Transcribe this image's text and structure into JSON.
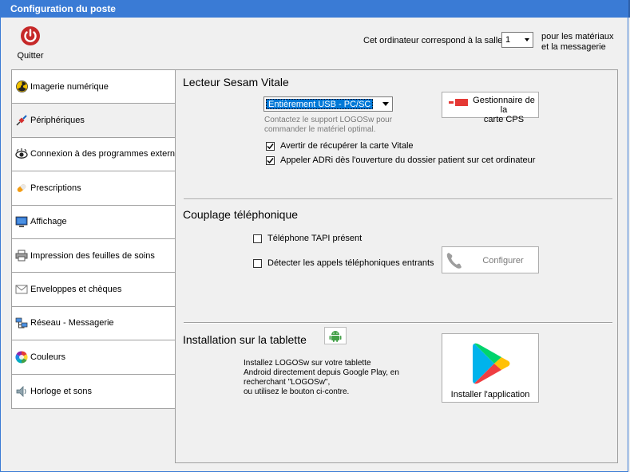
{
  "window": {
    "title": "Configuration du poste"
  },
  "toolbar": {
    "quit_label": "Quitter"
  },
  "salle": {
    "label": "Cet ordinateur correspond à la salle",
    "value": "1",
    "suffix_line1": "pour les matériaux",
    "suffix_line2": "et la messagerie"
  },
  "nav": {
    "items": [
      {
        "label": "Imagerie numérique",
        "icon": "radiation-icon"
      },
      {
        "label": "Périphériques",
        "icon": "cable-icon"
      },
      {
        "label": "Connexion à des programmes externes",
        "icon": "eye-icon"
      },
      {
        "label": "Prescriptions",
        "icon": "pill-icon"
      },
      {
        "label": "Affichage",
        "icon": "monitor-icon"
      },
      {
        "label": "Impression des feuilles de soins",
        "icon": "printer-icon"
      },
      {
        "label": "Enveloppes et chèques",
        "icon": "envelope-icon"
      },
      {
        "label": "Réseau - Messagerie",
        "icon": "network-icon"
      },
      {
        "label": "Couleurs",
        "icon": "color-wheel-icon"
      },
      {
        "label": "Horloge et sons",
        "icon": "speaker-icon"
      }
    ]
  },
  "sesam": {
    "title": "Lecteur Sesam Vitale",
    "reader_value": "Entièrement USB - PC/SC",
    "hint_line1": "Contactez le support LOGOSw pour",
    "hint_line2": "commander le matériel optimal.",
    "cps_button_line1": "Gestionnaire de la",
    "cps_button_line2": "carte CPS",
    "check_vitale": "Avertir de récupérer la carte Vitale",
    "check_adri": "Appeler ADRi dès l'ouverture du dossier patient sur cet ordinateur"
  },
  "phone": {
    "title": "Couplage téléphonique",
    "check_tapi": "Téléphone TAPI présent",
    "check_incoming": "Détecter les appels téléphoniques entrants",
    "configure_label": "Configurer"
  },
  "tablet": {
    "title": "Installation sur la tablette",
    "text_line1": "Installez LOGOSw sur votre tablette",
    "text_line2": "Android directement depuis Google Play, en",
    "text_line3": "recherchant \"LOGOSw\",",
    "text_line4": "ou utilisez le bouton ci-contre.",
    "install_label": "Installer l'application"
  },
  "colors": {
    "titlebar": "#3a7bd5",
    "selection": "#0078d7",
    "quit_red": "#c62828"
  }
}
